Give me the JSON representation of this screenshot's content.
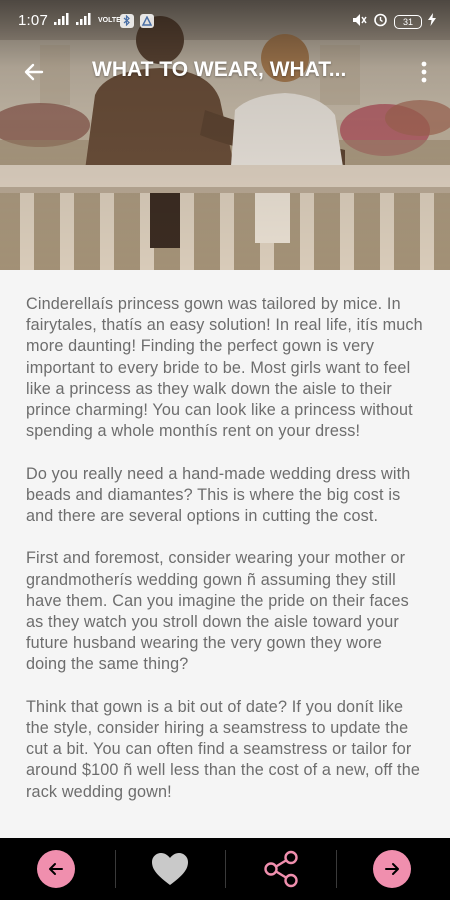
{
  "status_bar": {
    "time": "1:07",
    "network_label": "VOLTE",
    "battery": "31",
    "icons": [
      "signal-icon",
      "signal-icon",
      "volte-icon",
      "bluetooth-icon",
      "app-notification-icon",
      "mute-icon",
      "alarm-icon",
      "battery-icon",
      "charging-icon"
    ]
  },
  "app_bar": {
    "title": "WHAT TO WEAR, WHAT..."
  },
  "article": {
    "paragraphs": [
      "Cinderellaís princess gown was tailored by mice. In fairytales, thatís an easy solution! In real life, itís much more daunting! Finding the perfect gown is very important to every bride to be. Most girls want to feel like a princess as they walk down the aisle to their prince charming! You can look like a princess without spending a whole monthís rent on your dress!",
      "Do you really need a hand-made wedding dress with beads and diamantes? This is where the big cost is and there are several options in cutting the cost.",
      "First and foremost, consider wearing your mother or grandmotherís wedding gown ñ assuming they still have them. Can you imagine the pride on their faces as they watch you stroll down the aisle toward your future husband wearing the very gown they wore doing the same thing?",
      "Think that gown is a bit out of date? If you donít like the style, consider hiring a seamstress to update the cut a bit. You can often find a seamstress or tailor for around $100 ñ well less than the cost of a new, off the rack wedding gown!"
    ]
  },
  "bottom_bar": {
    "items": [
      "previous",
      "favorite",
      "share",
      "next"
    ]
  },
  "colors": {
    "accent": "#f08fae",
    "bottom_bar_bg": "#000000",
    "body_text": "#6d6d6d",
    "article_bg": "#f5f5f5"
  }
}
